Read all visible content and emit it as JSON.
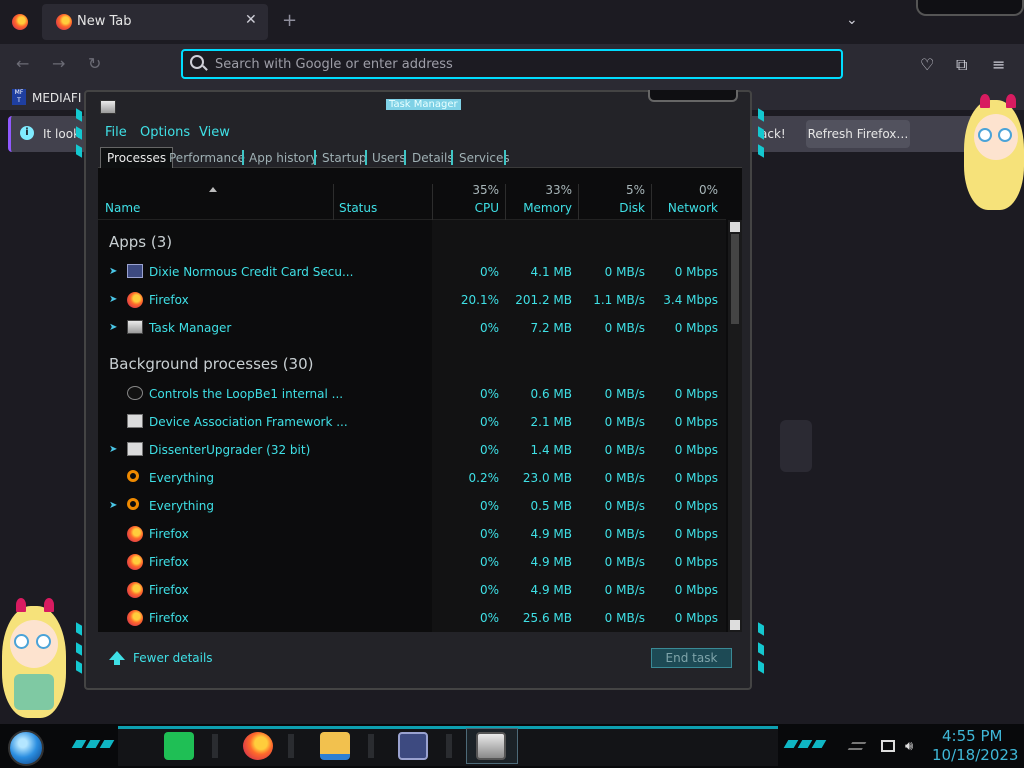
{
  "browser": {
    "tab_title": "New Tab",
    "tab_close": "✕",
    "new_tab": "+",
    "tab_list": "⌄",
    "url_placeholder": "Search with Google or enter address",
    "bookmark_label": "MEDIAFI",
    "bookmark_icon_text": "MF T",
    "notice_text": "It look",
    "notice_back": "ack!",
    "refresh_button": "Refresh Firefox…",
    "nav": {
      "back": "←",
      "forward": "→",
      "reload": "↻"
    },
    "toolbar": {
      "pocket": "♡",
      "extensions": "⧉",
      "menu": "≡"
    }
  },
  "task_manager": {
    "title": "Task Manager",
    "menu": [
      "File",
      "Options",
      "View"
    ],
    "tabs": [
      "Processes",
      "Performance",
      "App history",
      "Startup",
      "Users",
      "Details",
      "Services"
    ],
    "columns": {
      "name": "Name",
      "status": "Status",
      "cpu_pct": "35%",
      "cpu": "CPU",
      "memory_pct": "33%",
      "memory": "Memory",
      "disk_pct": "5%",
      "disk": "Disk",
      "network_pct": "0%",
      "network": "Network"
    },
    "groups": {
      "apps": "Apps (3)",
      "background": "Background processes (30)"
    },
    "apps": [
      {
        "name": "Dixie Normous Credit Card Secu...",
        "cpu": "0%",
        "memory": "4.1 MB",
        "disk": "0 MB/s",
        "network": "0 Mbps",
        "icon": "card-icon",
        "expandable": true
      },
      {
        "name": "Firefox",
        "cpu": "20.1%",
        "memory": "201.2 MB",
        "disk": "1.1 MB/s",
        "network": "3.4 Mbps",
        "icon": "firefox-icon",
        "expandable": true
      },
      {
        "name": "Task Manager",
        "cpu": "0%",
        "memory": "7.2 MB",
        "disk": "0 MB/s",
        "network": "0 Mbps",
        "icon": "task-manager-icon",
        "expandable": true
      }
    ],
    "background": [
      {
        "name": "Controls the LoopBe1 internal ...",
        "cpu": "0%",
        "memory": "0.6 MB",
        "disk": "0 MB/s",
        "network": "0 Mbps",
        "icon": "loopbe-icon",
        "expandable": false
      },
      {
        "name": "Device Association Framework ...",
        "cpu": "0%",
        "memory": "2.1 MB",
        "disk": "0 MB/s",
        "network": "0 Mbps",
        "icon": "window-icon",
        "expandable": false
      },
      {
        "name": "DissenterUpgrader (32 bit)",
        "cpu": "0%",
        "memory": "1.4 MB",
        "disk": "0 MB/s",
        "network": "0 Mbps",
        "icon": "window-icon",
        "expandable": true
      },
      {
        "name": "Everything",
        "cpu": "0.2%",
        "memory": "23.0 MB",
        "disk": "0 MB/s",
        "network": "0 Mbps",
        "icon": "search-icon",
        "expandable": false
      },
      {
        "name": "Everything",
        "cpu": "0%",
        "memory": "0.5 MB",
        "disk": "0 MB/s",
        "network": "0 Mbps",
        "icon": "search-icon",
        "expandable": true
      },
      {
        "name": "Firefox",
        "cpu": "0%",
        "memory": "4.9 MB",
        "disk": "0 MB/s",
        "network": "0 Mbps",
        "icon": "firefox-icon",
        "expandable": false
      },
      {
        "name": "Firefox",
        "cpu": "0%",
        "memory": "4.9 MB",
        "disk": "0 MB/s",
        "network": "0 Mbps",
        "icon": "firefox-icon",
        "expandable": false
      },
      {
        "name": "Firefox",
        "cpu": "0%",
        "memory": "4.9 MB",
        "disk": "0 MB/s",
        "network": "0 Mbps",
        "icon": "firefox-icon",
        "expandable": false
      },
      {
        "name": "Firefox",
        "cpu": "0%",
        "memory": "25.6 MB",
        "disk": "0 MB/s",
        "network": "0 Mbps",
        "icon": "firefox-icon",
        "expandable": false
      }
    ],
    "fewer_details": "Fewer details",
    "end_task": "End task"
  },
  "taskbar": {
    "clock_time": "4:55 PM",
    "clock_date": "10/18/2023",
    "volume_icon": "🔊︎"
  },
  "colors": {
    "accent": "#3fe0e6",
    "url_focus": "#00ddff",
    "background": "#1c1b22"
  }
}
